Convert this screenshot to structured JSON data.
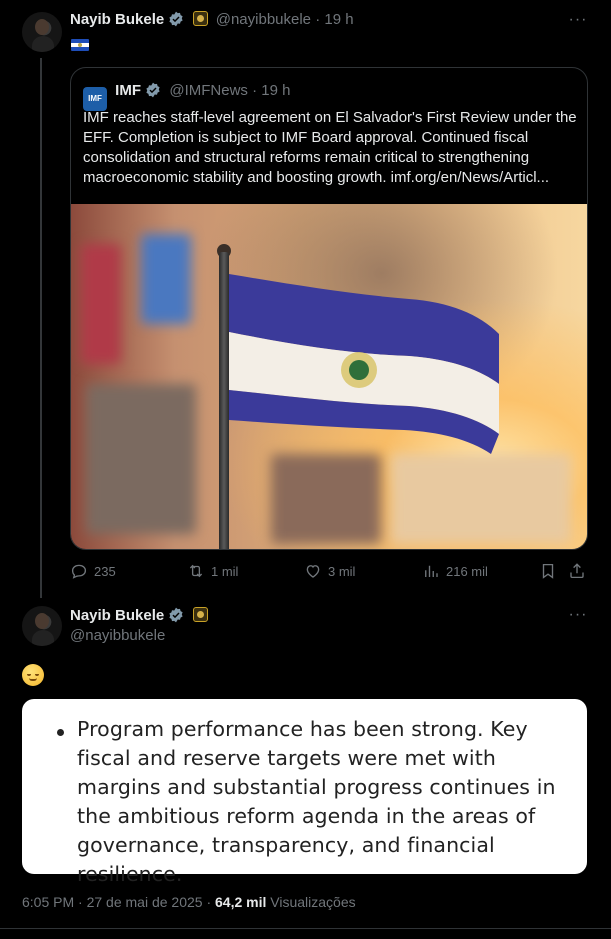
{
  "tweet1": {
    "name": "Nayib Bukele",
    "handle": "@nayibbukele",
    "time": "19 h",
    "dot": "·"
  },
  "quote": {
    "name": "IMF",
    "logo_text": "IMF",
    "handle": "@IMFNews",
    "time": "19 h",
    "dot": "·",
    "text": "IMF reaches staff-level agreement on El Salvador's First Review under the EFF. Completion is subject to IMF Board approval. Continued fiscal consolidation and structural reforms remain critical to strengthening macroeconomic stability and boosting growth. imf.org/en/News/Articl..."
  },
  "actions": {
    "replies": "235",
    "reposts": "1 mil",
    "likes": "3 mil",
    "views": "216 mil"
  },
  "tweet2": {
    "name": "Nayib Bukele",
    "handle": "@nayibbukele",
    "card_text": "Program performance has been strong. Key fiscal and reserve targets were met with margins and substantial progress continues in the ambitious reform agenda in the areas of governance, transparency, and financial resilience.",
    "timestamp": "6:05 PM · 27 de mai de 2025 · ",
    "views_count": "64,2 mil",
    "views_label": " Visualizações"
  },
  "colors": {
    "background": "#000000",
    "text": "#e7e9ea",
    "muted": "#71767b",
    "verified": "#829aab",
    "border": "#2f3336"
  },
  "icons": [
    "more-icon",
    "verified-icon",
    "gold-badge-icon",
    "flag-icon",
    "reply-icon",
    "repost-icon",
    "like-icon",
    "views-icon",
    "bookmark-icon",
    "share-icon",
    "emoji-relieved-icon"
  ]
}
